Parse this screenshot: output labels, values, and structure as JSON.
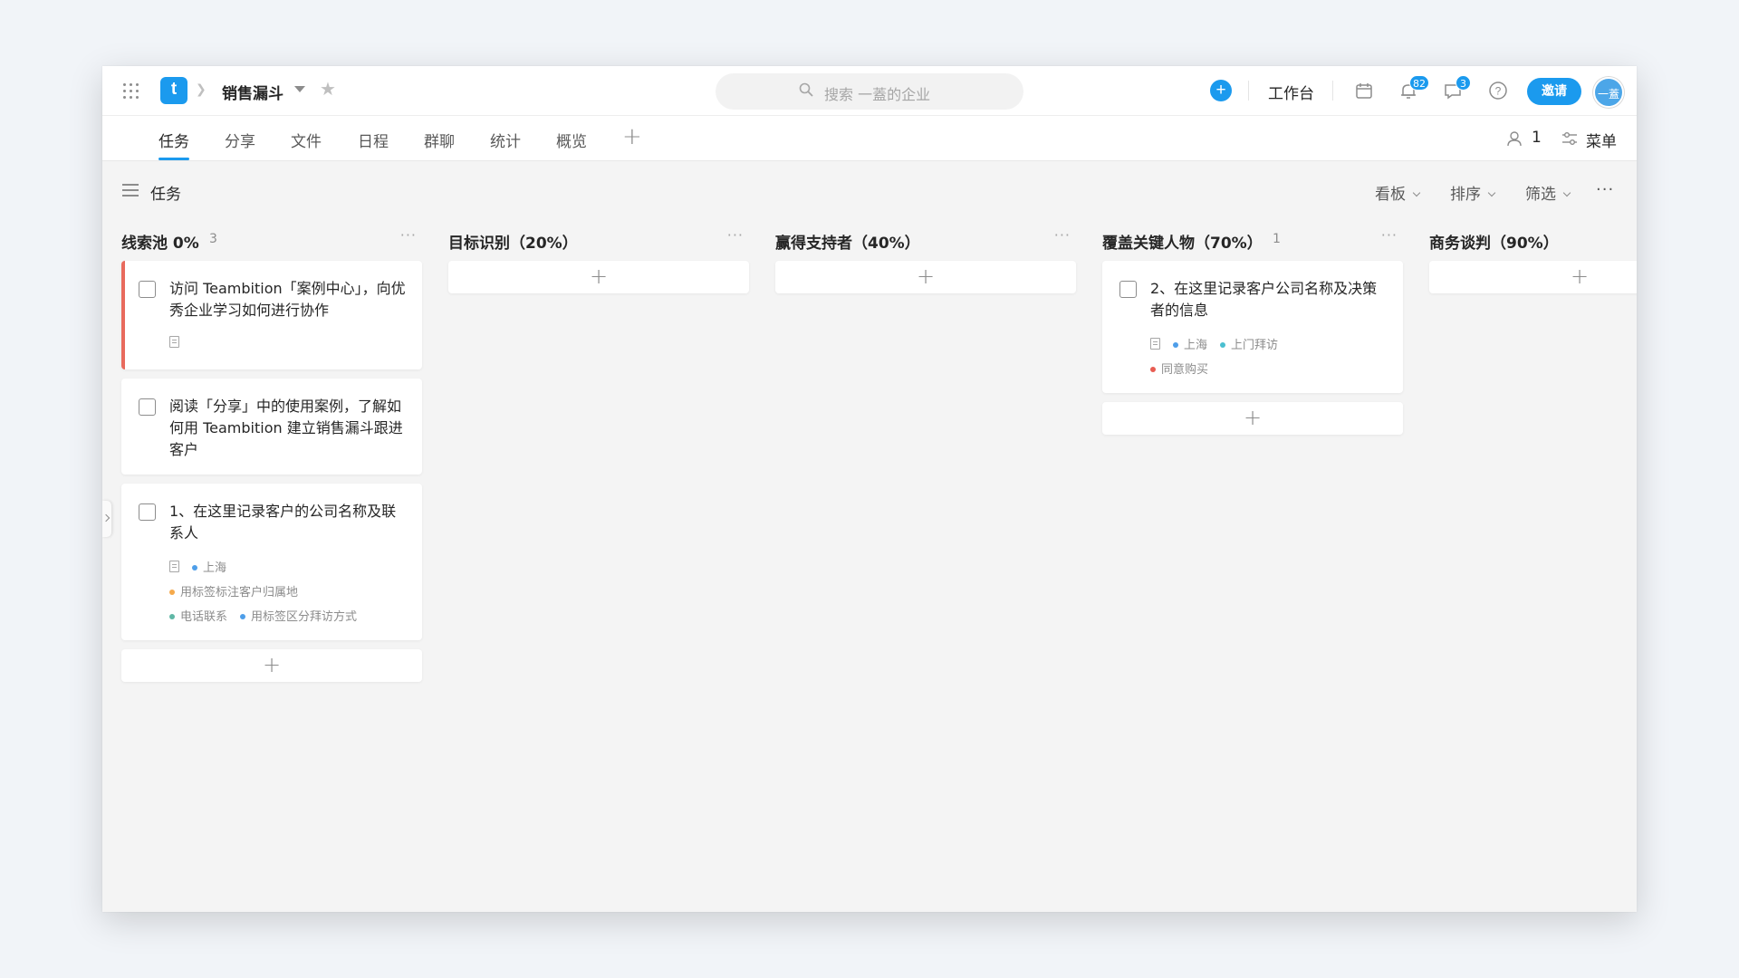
{
  "colors": {
    "accent": "#1b9aee",
    "card_red_bar": "#e86a5d",
    "tag_blue": "#4e9ee9",
    "tag_orange": "#f5a94b",
    "tag_teal": "#5fb7a5",
    "tag_cyan": "#4bbfd0",
    "tag_red": "#e85c52"
  },
  "header": {
    "logo_letter": "t",
    "project_name": "销售漏斗",
    "search_placeholder": "搜索 一蓋的企业",
    "workbench": "工作台",
    "notifications_badge": "82",
    "messages_badge": "3",
    "invite": "邀请",
    "avatar_text": "一蓋",
    "icons": [
      "apps-grid-icon",
      "chevron-right-icon",
      "caret-down-icon",
      "star-icon",
      "search-icon",
      "plus-circle-icon",
      "calendar-icon",
      "bell-icon",
      "chat-icon",
      "help-icon"
    ]
  },
  "tabs": [
    {
      "label": "任务",
      "active": true
    },
    {
      "label": "分享"
    },
    {
      "label": "文件"
    },
    {
      "label": "日程"
    },
    {
      "label": "群聊"
    },
    {
      "label": "统计"
    },
    {
      "label": "概览"
    }
  ],
  "tabbar_right": {
    "member_count": "1",
    "menu": "菜单"
  },
  "toolbar": {
    "view_title": "任务",
    "board": "看板",
    "sort": "排序",
    "filter": "筛选",
    "more": "···"
  },
  "columns": [
    {
      "title": "线索池 0%",
      "count": "3",
      "cards": [
        {
          "text": "访问 Teambition「案例中心」，向优秀企业学习如何进行协作",
          "red_bar": true,
          "has_note": true,
          "tags": []
        },
        {
          "text": "阅读「分享」中的使用案例，了解如何用 Teambition 建立销售漏斗跟进客户",
          "tags": []
        },
        {
          "text": "1、在这里记录客户的公司名称及联系人",
          "has_note": true,
          "tag_rows": [
            [
              {
                "label": "上海",
                "color": "#4e9ee9"
              }
            ],
            [
              {
                "label": "用标签标注客户归属地",
                "color": "#f5a94b"
              }
            ],
            [
              {
                "label": "电话联系",
                "color": "#5fb7a5"
              },
              {
                "label": "用标签区分拜访方式",
                "color": "#4e9ee9"
              }
            ]
          ]
        }
      ]
    },
    {
      "title": "目标识别（20%）",
      "count": "",
      "cards": []
    },
    {
      "title": "赢得支持者（40%）",
      "count": "",
      "cards": []
    },
    {
      "title": "覆盖关键人物（70%）",
      "count": "1",
      "cards": [
        {
          "text": "2、在这里记录客户公司名称及决策者的信息",
          "has_note": true,
          "tag_rows": [
            [
              {
                "label": "上海",
                "color": "#4e9ee9"
              },
              {
                "label": "上门拜访",
                "color": "#4bbfd0"
              }
            ],
            [
              {
                "label": "同意购买",
                "color": "#e85c52"
              }
            ]
          ]
        }
      ]
    },
    {
      "title": "商务谈判（90%）",
      "count": "",
      "cards": []
    }
  ],
  "add_symbol": "+"
}
